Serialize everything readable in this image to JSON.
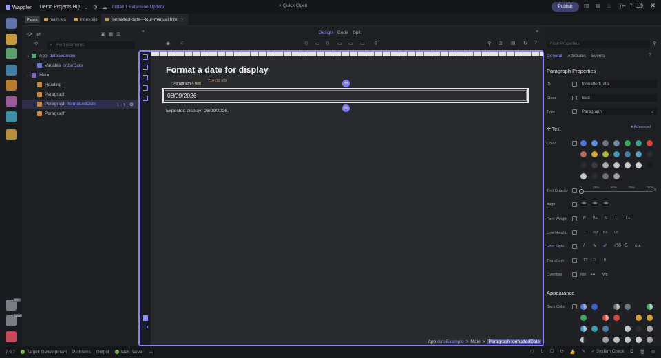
{
  "app": {
    "name": "Wappler",
    "project": "Demo Projects HQ",
    "extension_update": "Install 1 Extension Update",
    "quick_open": "Quick Open",
    "publish": "Publish"
  },
  "tabs": [
    {
      "label": "Pages"
    },
    {
      "label": "main.ejs"
    },
    {
      "label": "index.ejs"
    },
    {
      "label": "formatted-date---tour-manual.html"
    }
  ],
  "left": {
    "search_placeholder": "Find Elements",
    "tree": [
      {
        "label": "App",
        "accent": "dateExample"
      },
      {
        "label": "Variable",
        "accent": "orderDate"
      },
      {
        "label": "Main",
        "accent": ""
      },
      {
        "label": "Heading",
        "accent": ""
      },
      {
        "label": "Paragraph",
        "accent": ""
      },
      {
        "label": "Paragraph",
        "accent": "formattedDate"
      },
      {
        "label": "Paragraph",
        "accent": ""
      }
    ]
  },
  "views": {
    "design": "Design",
    "code": "Code",
    "split": "Split"
  },
  "canvas": {
    "heading": "Format a date for display",
    "tiny_text": "T14:30:00",
    "crumb_tag": "Paragraph",
    "crumb_tag_text": "text",
    "selected_value": "08/09/2026",
    "expected": "Expected display: 08/09/2026.",
    "breadcrumb": {
      "app": "App",
      "app_name": "dateExample",
      "main": "Main",
      "para": "Paragraph",
      "para_name": "formattedDate"
    }
  },
  "right": {
    "filter_placeholder": "Filter Properties",
    "tabs": [
      "General",
      "Attributes",
      "Events"
    ],
    "title": "Paragraph Properties",
    "id_label": "ID",
    "id_value": "formattedDate",
    "class_label": "Class",
    "class_value": "lead",
    "type_label": "Type",
    "type_value": "Paragraph",
    "text_section": "Text",
    "advanced": "Advanced",
    "color_label": "Color",
    "opacity_label": "Text Opacity",
    "opacity_marks": [
      "0",
      "25%",
      "50%",
      "75%",
      "100%"
    ],
    "align_label": "Align",
    "weight_label": "Font Weight",
    "weight_opts": [
      "B",
      "B+",
      "N",
      "L",
      "L+"
    ],
    "lineheight_label": "Line Height",
    "lineheight_opts": [
      "1",
      "SM",
      "BS",
      "LG"
    ],
    "fontstyle_label": "Font Style",
    "fontstyle_na": "N/A",
    "transform_label": "Transform",
    "transform_opts": [
      "TT",
      "Tt",
      "tt"
    ],
    "overflow_label": "Overflow",
    "overflow_opts": [
      "NW",
      "•••",
      "Wb"
    ],
    "appearance": "Appearance",
    "backcolor_label": "Back Color"
  },
  "bottom": {
    "version": "7.9.7",
    "target": "Target: Development",
    "problems": "Problems",
    "output": "Output",
    "server": "Web Server",
    "system_check": "System Check"
  },
  "colors": {
    "accent": "#8c93ff",
    "frame": "#8e7cff",
    "plus": "#7f7bff"
  }
}
